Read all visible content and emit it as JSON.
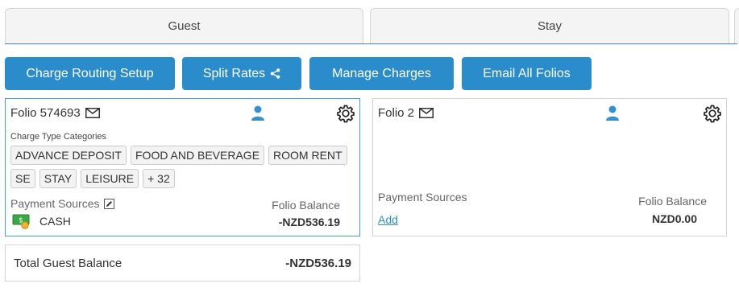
{
  "tabs": [
    {
      "label": "Guest"
    },
    {
      "label": "Stay"
    }
  ],
  "toolbar": {
    "charge_routing": "Charge Routing Setup",
    "split_rates": "Split Rates",
    "manage_charges": "Manage Charges",
    "email_all": "Email All Folios"
  },
  "folios": [
    {
      "title": "Folio 574693",
      "categories_label": "Charge Type Categories",
      "categories": [
        "ADVANCE DEPOSIT",
        "FOOD AND BEVERAGE",
        "ROOM RENT",
        "SE",
        "STAY",
        "LEISURE",
        "+ 32"
      ],
      "payment_label": "Payment Sources",
      "payment_method": "CASH",
      "balance_label": "Folio Balance",
      "balance": "-NZD536.19"
    },
    {
      "title": "Folio 2",
      "payment_label": "Payment Sources",
      "add_label": "Add",
      "balance_label": "Folio Balance",
      "balance": "NZD0.00"
    }
  ],
  "total": {
    "label": "Total Guest Balance",
    "value": "-NZD536.19"
  },
  "colors": {
    "accent": "#2b8ccb",
    "border_active": "#4a9fd0"
  },
  "icons": [
    "envelope-icon",
    "user-icon",
    "gear-icon",
    "share-icon",
    "pencil-icon",
    "cash-icon"
  ]
}
